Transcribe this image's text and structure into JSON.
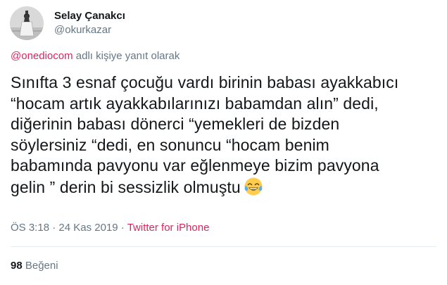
{
  "author": {
    "display_name": "Selay Çanakcı",
    "handle": "@okurkazar",
    "avatar_icon": "profile-photo"
  },
  "reply_context": {
    "mention": "@onediocom",
    "suffix": " adlı kişiye yanıt olarak"
  },
  "tweet": {
    "lines": [
      "Sınıfta 3 esnaf çocuğu vardı birinin babası ayakkabıcı",
      "“hocam artık ayakkabılarınızı babamdan alın” dedi,",
      "diğerinin babası dönerci “yemekleri de bizden",
      "söylersiniz “dedi, en sonuncu “hocam benim",
      "babamında pavyonu var eğlenmeye bizim pavyona",
      "gelin ” derin bi sessizlik olmuştu"
    ],
    "emoji": "face-with-tears-of-joy"
  },
  "meta": {
    "time": "ÖS 3:18",
    "separator": " · ",
    "date": "24 Kas 2019",
    "source": "Twitter for iPhone"
  },
  "stats": {
    "likes_count": "98",
    "likes_label": " Beğeni"
  },
  "colors": {
    "text": "#14171a",
    "secondary": "#657786",
    "link": "#e0245e",
    "divider": "#e6ecf0"
  }
}
